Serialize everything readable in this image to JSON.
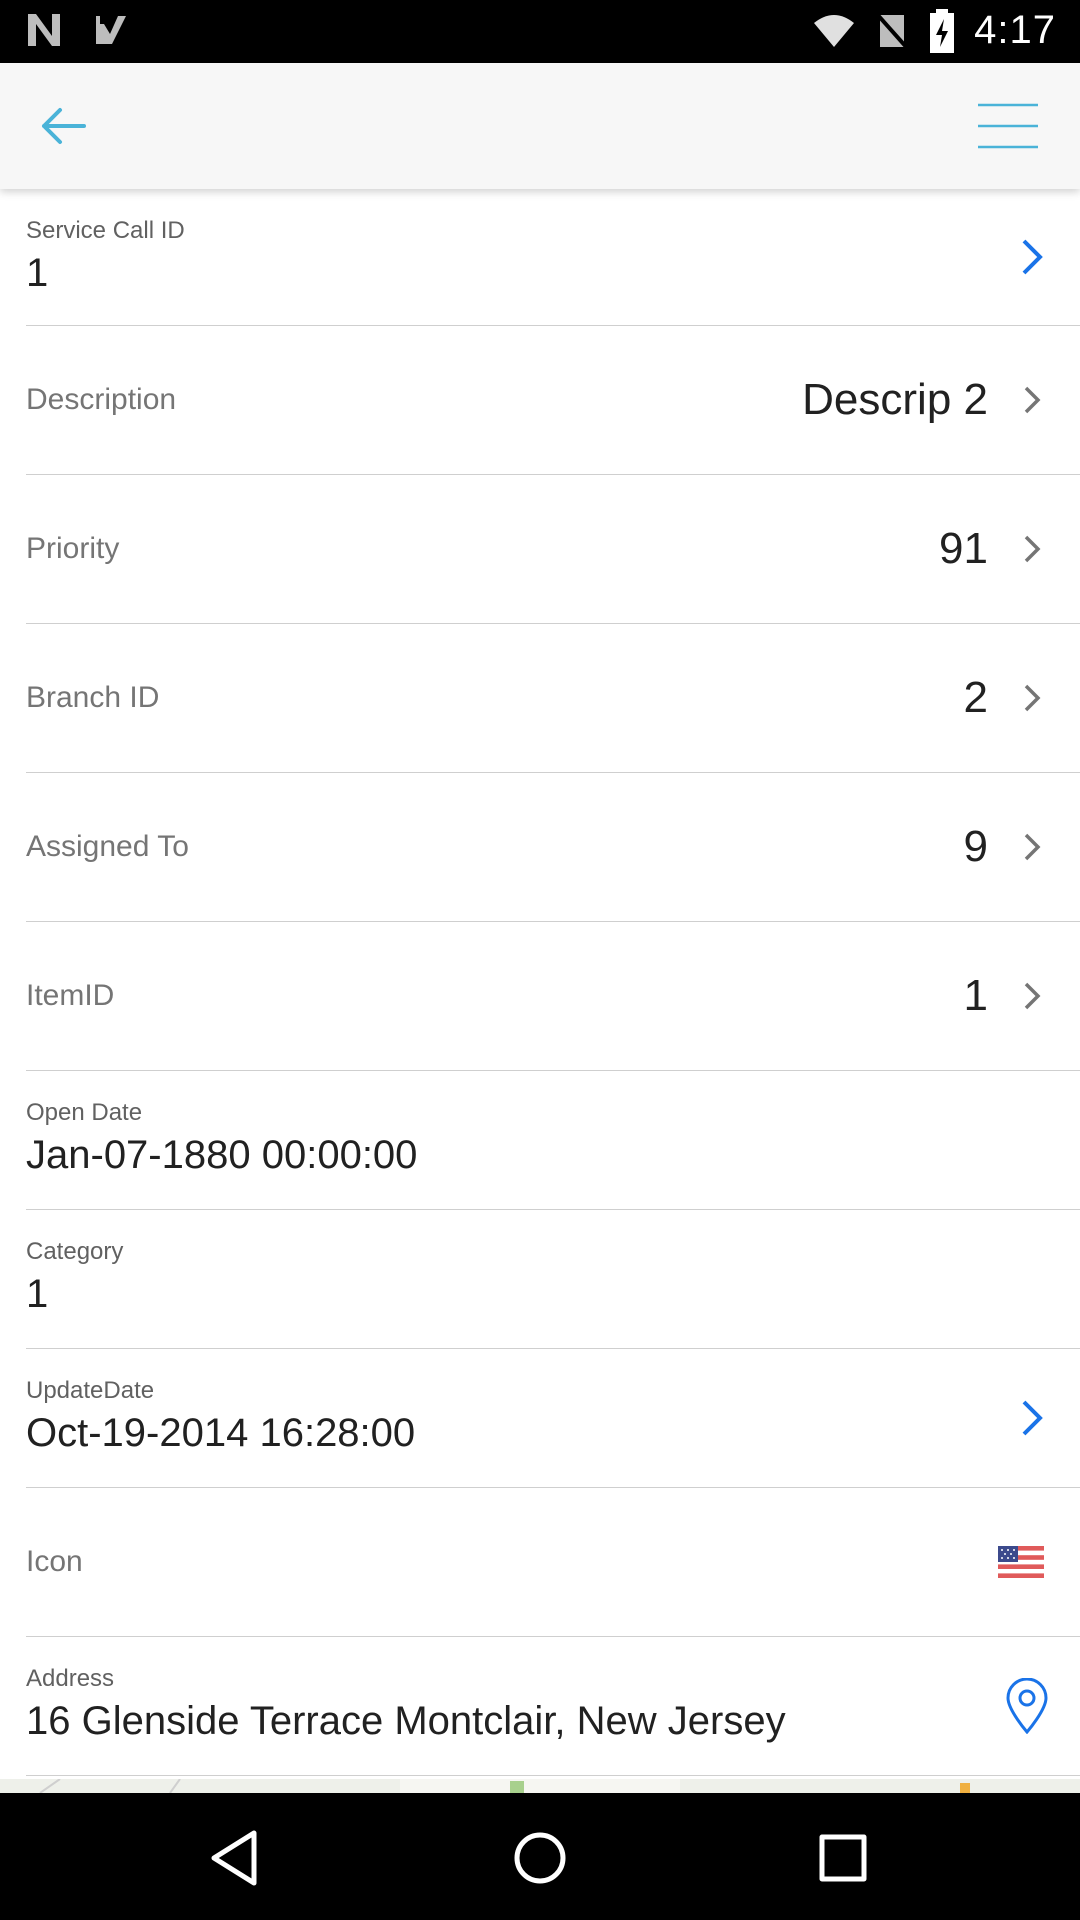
{
  "status_bar": {
    "time": "4:17",
    "icons": [
      "n-notification-icon",
      "checkmark-notification-icon",
      "wifi-icon",
      "no-sim-icon",
      "battery-charging-icon"
    ]
  },
  "app_bar": {
    "back_icon": "arrow-left-icon",
    "menu_icon": "hamburger-menu-icon",
    "accent_color": "#4ab3d8"
  },
  "fields": {
    "service_call_id": {
      "label": "Service Call ID",
      "value": "1"
    },
    "description": {
      "label": "Description",
      "value": "Descrip 2"
    },
    "priority": {
      "label": "Priority",
      "value": "91"
    },
    "branch_id": {
      "label": "Branch ID",
      "value": "2"
    },
    "assigned_to": {
      "label": "Assigned To",
      "value": "9"
    },
    "item_id": {
      "label": "ItemID",
      "value": "1"
    },
    "open_date": {
      "label": "Open Date",
      "value": "Jan-07-1880 00:00:00"
    },
    "category": {
      "label": "Category",
      "value": "1"
    },
    "update_date": {
      "label": "UpdateDate",
      "value": "Oct-19-2014 16:28:00"
    },
    "icon": {
      "label": "Icon",
      "icon_name": "us-flag-icon"
    },
    "address": {
      "label": "Address",
      "value": "16 Glenside Terrace Montclair, New Jersey"
    }
  },
  "colors": {
    "link_chevron": "#1a73e8",
    "gray_chevron": "#757575",
    "divider": "#cfcfcf"
  },
  "nav_bar": {
    "icons": [
      "back-triangle-icon",
      "home-circle-icon",
      "recents-square-icon"
    ]
  }
}
